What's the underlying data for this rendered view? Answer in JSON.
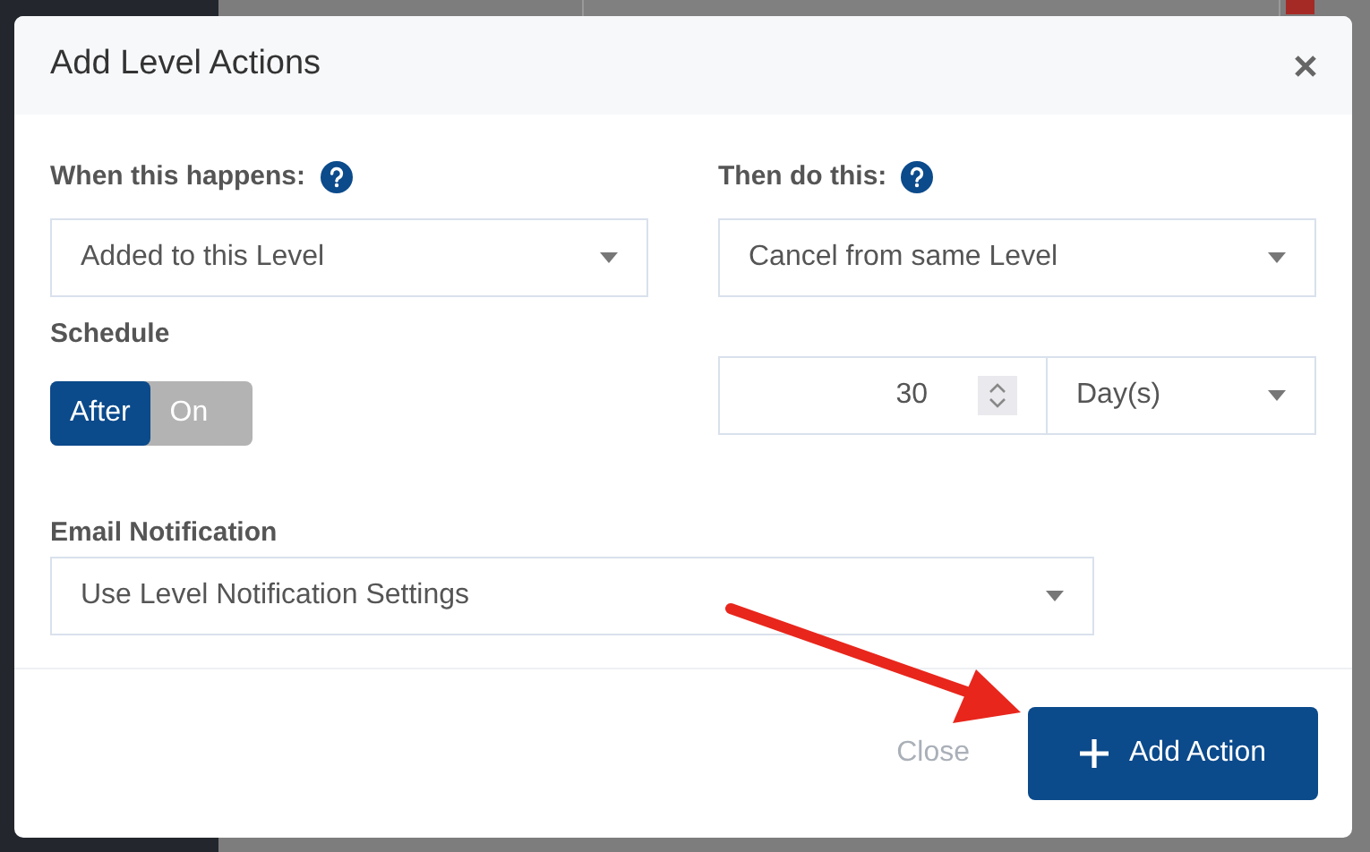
{
  "dialog": {
    "title": "Add Level Actions",
    "trigger": {
      "label": "When this happens:",
      "value": "Added to this Level"
    },
    "action": {
      "label": "Then do this:",
      "value": "Cancel from same Level"
    },
    "schedule": {
      "label": "Schedule",
      "options": [
        {
          "label": "After",
          "selected": true
        },
        {
          "label": "On",
          "selected": false
        }
      ],
      "amount": {
        "value": "30"
      },
      "unit": {
        "value": "Day(s)"
      }
    },
    "email_notification": {
      "label": "Email Notification",
      "value": "Use Level Notification Settings"
    },
    "buttons": [
      {
        "kind": "secondary",
        "label": "Close"
      },
      {
        "kind": "primary",
        "label": "Add Action"
      }
    ]
  }
}
